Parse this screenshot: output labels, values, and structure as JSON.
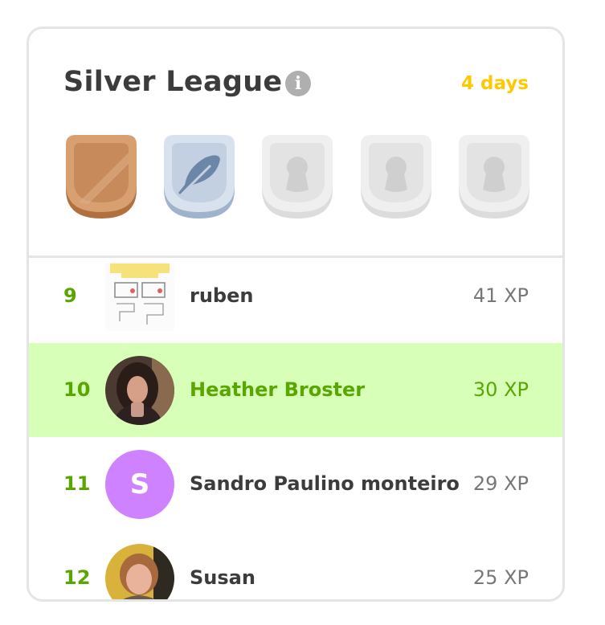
{
  "league": {
    "title": "Silver League",
    "time_left": "4 days",
    "info_icon": "info-icon",
    "badges": [
      {
        "name": "bronze",
        "state": "unlocked",
        "color": "#cd8b5c"
      },
      {
        "name": "silver",
        "state": "current",
        "color": "#c3d1e3",
        "icon": "feather-icon"
      },
      {
        "name": "locked-3",
        "state": "locked",
        "color": "#e5e5e5",
        "icon": "keyhole-icon"
      },
      {
        "name": "locked-4",
        "state": "locked",
        "color": "#e5e5e5",
        "icon": "keyhole-icon"
      },
      {
        "name": "locked-5",
        "state": "locked",
        "color": "#e5e5e5",
        "icon": "keyhole-icon"
      }
    ]
  },
  "leaderboard": [
    {
      "rank": "9",
      "name": "ruben",
      "xp": "41 XP",
      "avatar": "image",
      "highlight": false
    },
    {
      "rank": "10",
      "name": "Heather Broster",
      "xp": "30 XP",
      "avatar": "photo",
      "highlight": true
    },
    {
      "rank": "11",
      "name": "Sandro Paulino monteiro",
      "xp": "29 XP",
      "avatar": "letter",
      "avatar_letter": "S",
      "avatar_color": "#ce82ff",
      "highlight": false
    },
    {
      "rank": "12",
      "name": "Susan",
      "xp": "25 XP",
      "avatar": "photo",
      "highlight": false
    }
  ],
  "colors": {
    "highlight_bg": "#d7ffb8",
    "rank_green": "#58a700",
    "gold": "#ffc800"
  }
}
